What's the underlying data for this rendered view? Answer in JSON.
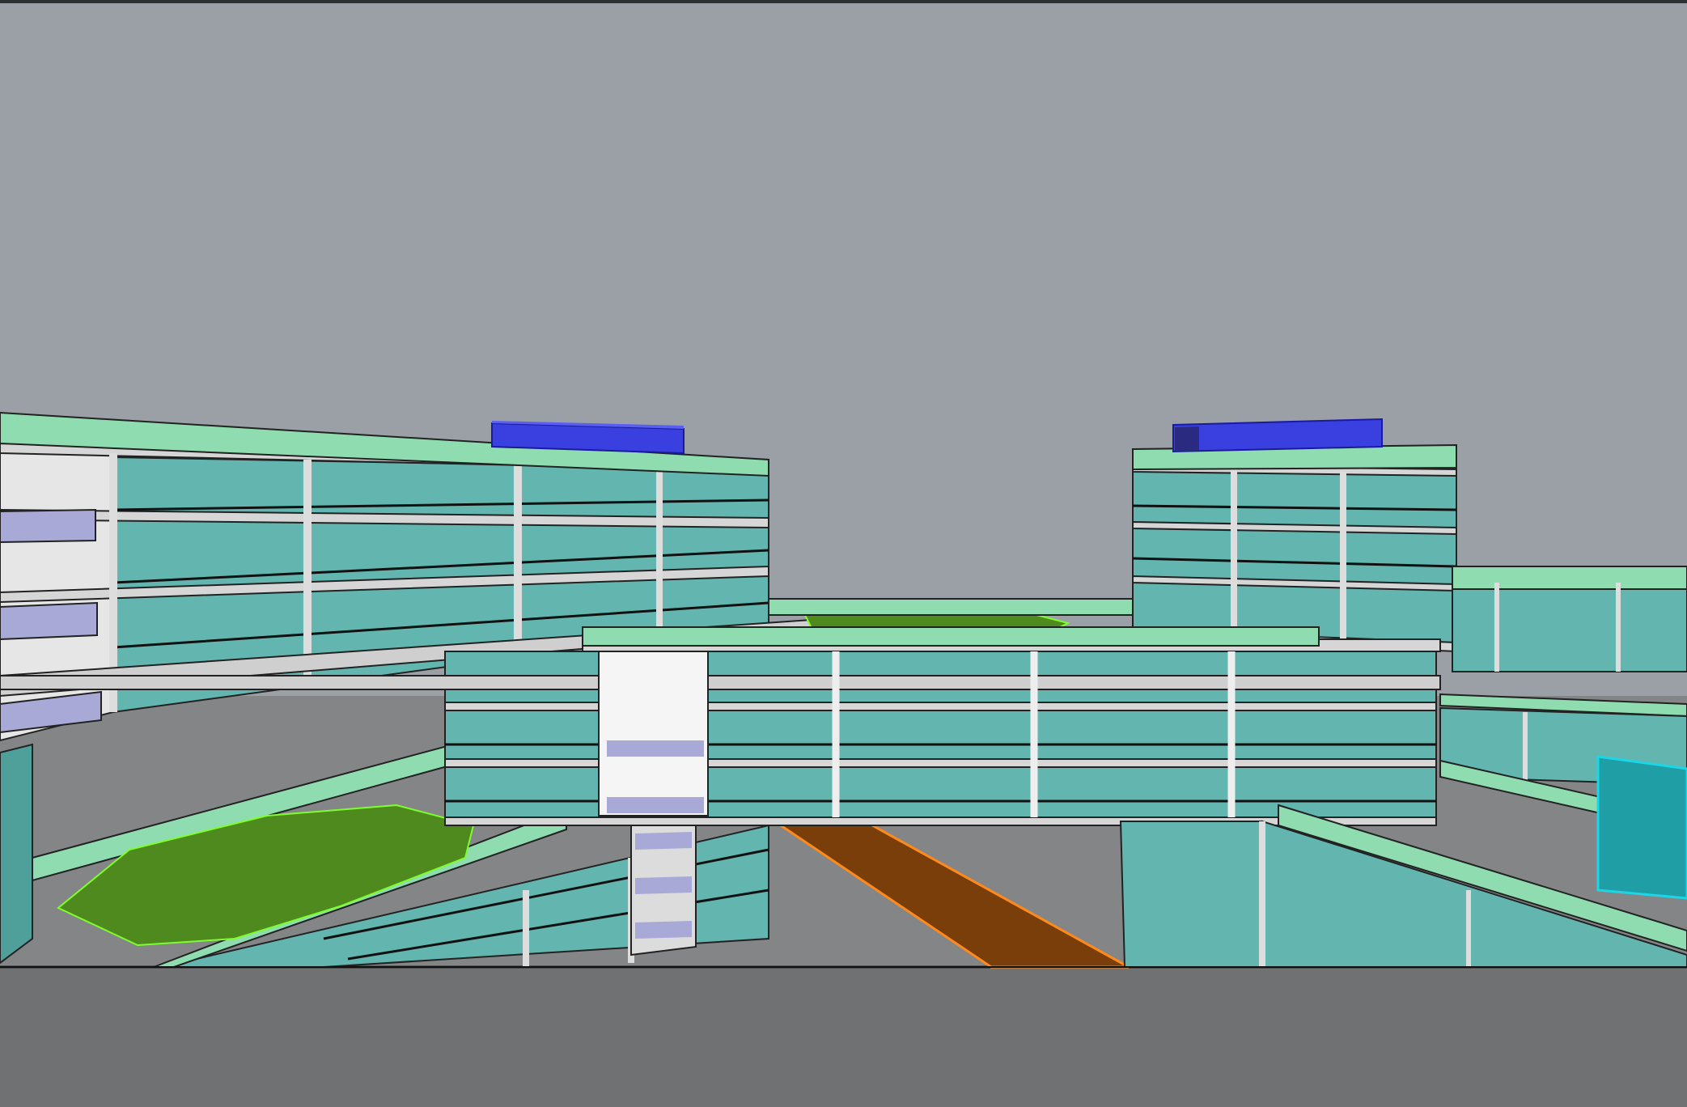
{
  "colors": {
    "sky": "#9aa0a6",
    "ground": "#848587",
    "viewport_bottom": "#707173",
    "glass": "#63b5b0",
    "glass_dark": "#4f9f9b",
    "rail": "#8fdcb0",
    "slab": "#d6d6d6",
    "roof_unit": "#3a3fe0",
    "garden": "#4f8a1f",
    "garden_edge": "#7cff2a",
    "ramp": "#7a3e0b",
    "ramp_edge": "#ff8a1a",
    "balcony": "#a9a9d8",
    "cyan_edge": "#1ad6e6"
  }
}
